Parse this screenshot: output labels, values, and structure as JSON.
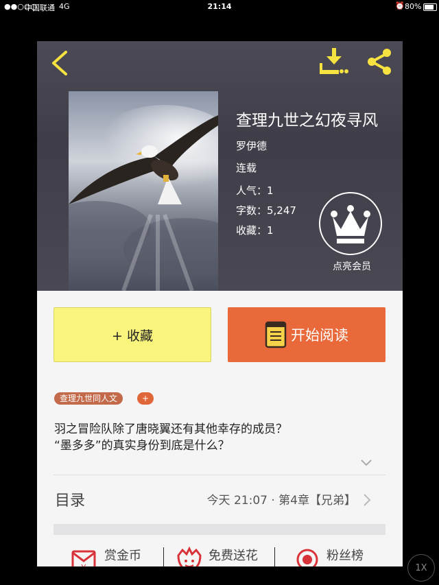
{
  "status_bar": {
    "carrier": "中国联通",
    "network": "4G",
    "time": "21:14",
    "battery": "80%",
    "battery_level": 0.8
  },
  "header": {
    "icons": [
      "back-icon",
      "download-icon",
      "share-icon"
    ],
    "accent_color": "#f6e340"
  },
  "book": {
    "title": "查理九世之幻夜寻风",
    "author": "罗伊德",
    "status": "连载",
    "popularity": "人气：1",
    "word_count": "字数：5,247",
    "favorites": "收藏：1"
  },
  "vip": {
    "label": "点亮会员",
    "icon": "crown-icon"
  },
  "buttons": {
    "collect": "+ 收藏",
    "read": "开始阅读",
    "collect_color": "#f9f57c",
    "read_color": "#e9693a"
  },
  "tags": {
    "category": "查理九世同人文",
    "add": "+"
  },
  "description": {
    "line1": "羽之冒险队除了唐晓翼还有其他幸存的成员？",
    "line2": "“墨多多”的真实身份到底是什么？"
  },
  "toc": {
    "label": "目录",
    "latest": "今天 21:07 · 第4章【兄弟】"
  },
  "actions": [
    {
      "label": "赏金币",
      "icon": "coin-envelope-icon"
    },
    {
      "label": "免费送花",
      "icon": "flower-icon"
    },
    {
      "label": "粉丝榜",
      "icon": "medal-icon"
    }
  ],
  "overlay": {
    "speed": "1X"
  }
}
